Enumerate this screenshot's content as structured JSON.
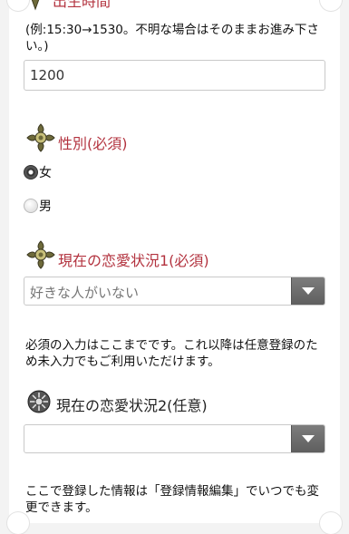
{
  "birth_time": {
    "title": "出生時間",
    "help_text": "(例:15:30→1530。不明な場合はそのままお進み下さい。)",
    "value": "1200"
  },
  "gender": {
    "title": "性別(必須)",
    "options": [
      "女",
      "男"
    ],
    "selected": "女"
  },
  "love_status_1": {
    "title": "現在の恋愛状況1(必須)",
    "selected": "好きな人がいない"
  },
  "required_note": "必須の入力はここまでです。これ以降は任意登録のため未入力でもご利用いただけます。",
  "love_status_2": {
    "title": "現在の恋愛状況2(任意)",
    "selected": ""
  },
  "footer_note": "ここで登録した情報は「登録情報編集」でいつでも変更できます。",
  "colors": {
    "required_heading": "#b3333f",
    "optional_heading": "#222222",
    "select_button": "#6b6b6b"
  },
  "icons": {
    "required_emblem": "ornate-cross-emblem-icon",
    "optional_emblem": "gear-medallion-icon",
    "select_arrow": "chevron-down-icon"
  }
}
